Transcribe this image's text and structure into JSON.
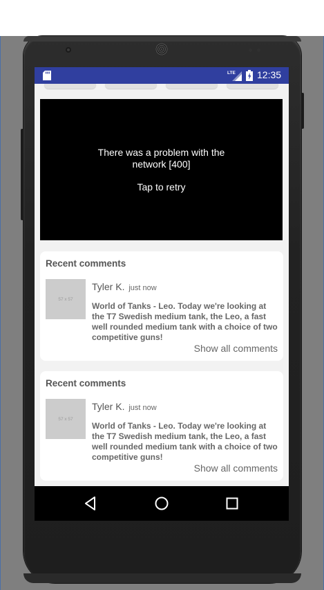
{
  "statusbar": {
    "time": "12:35",
    "network_label": "LTE",
    "icons": [
      "sd-card-icon",
      "lte-signal-icon",
      "battery-charging-icon"
    ]
  },
  "video": {
    "error_text": "There was a problem with the\nnetwork [400]",
    "retry_text": "Tap to retry"
  },
  "comment_cards": [
    {
      "title": "Recent comments",
      "thumb_text": "57 x 57",
      "author": "Tyler K.",
      "time": "just now",
      "body": "World of Tanks - Leo. Today we're looking at the T7 Swedish medium tank, the Leo, a fast well rounded medium tank with a choice of two competitive guns!",
      "show_all": "Show all comments"
    },
    {
      "title": "Recent comments",
      "thumb_text": "57 x 57",
      "author": "Tyler K.",
      "time": "just now",
      "body": "World of Tanks - Leo. Today we're looking at the T7 Swedish medium tank, the Leo, a fast well rounded medium tank with a choice of two competitive guns!",
      "show_all": "Show all comments"
    }
  ],
  "navbar": {
    "buttons": [
      "back-icon",
      "home-icon",
      "recents-icon"
    ]
  },
  "colors": {
    "statusbar": "#303f9f",
    "screen_bg": "#f2f2f2",
    "placeholder": "#cccccc"
  }
}
